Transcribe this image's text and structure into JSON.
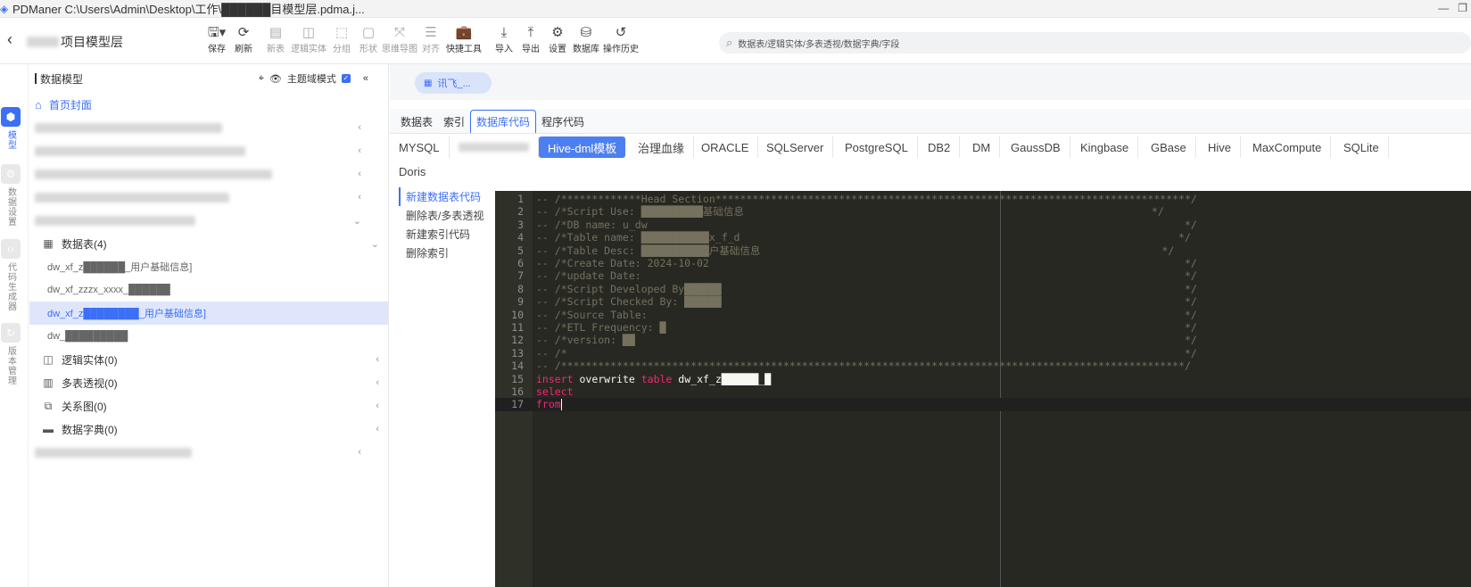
{
  "titlebar": {
    "title": "PDManer  C:\\Users\\Admin\\Desktop\\工作\\██████目模型层.pdma.j...",
    "icon": "pdmaner-logo-icon"
  },
  "toolbar": {
    "project_title": "项目模型层",
    "buttons": [
      {
        "label": "保存",
        "icon": "save-icon",
        "enabled": true
      },
      {
        "label": "刷新",
        "icon": "refresh-icon",
        "enabled": true
      },
      {
        "label": "新表",
        "icon": "new-table-icon",
        "enabled": false
      },
      {
        "label": "逻辑实体",
        "icon": "logic-entity-icon",
        "enabled": false
      },
      {
        "label": "分组",
        "icon": "group-icon",
        "enabled": false
      },
      {
        "label": "形状",
        "icon": "shape-icon",
        "enabled": false
      },
      {
        "label": "思维导图",
        "icon": "mindmap-icon",
        "enabled": false
      },
      {
        "label": "对齐",
        "icon": "align-icon",
        "enabled": false
      },
      {
        "label": "快捷工具",
        "icon": "toolbox-icon",
        "enabled": true
      },
      {
        "label": "导入",
        "icon": "import-icon",
        "enabled": true
      },
      {
        "label": "导出",
        "icon": "export-icon",
        "enabled": true
      },
      {
        "label": "设置",
        "icon": "settings-icon",
        "enabled": true
      },
      {
        "label": "数据库",
        "icon": "database-icon",
        "enabled": true
      },
      {
        "label": "操作历史",
        "icon": "history-icon",
        "enabled": true
      }
    ],
    "search_placeholder": "数据表/逻辑实体/多表透视/数据字典/字段"
  },
  "leftrail": [
    {
      "label": "模型",
      "icon": "model-cube-icon",
      "active": true
    },
    {
      "label": "数据设置",
      "icon": "data-settings-icon",
      "active": false
    },
    {
      "label": "代码生成器",
      "icon": "code-gen-icon",
      "active": false
    },
    {
      "label": "版本管理",
      "icon": "version-icon",
      "active": false
    }
  ],
  "sidebar": {
    "header": "数据模型",
    "theme_mode_label": "主题域模式",
    "home_label": "首页封面",
    "tables_group": "数据表(4)",
    "tables": [
      {
        "label": "dw_xf_z██████_用户基础信息]",
        "selected": false
      },
      {
        "label": "dw_xf_zzzx_xxxx_██████",
        "selected": false
      },
      {
        "label": "dw_xf_z████████_用户基础信息]",
        "selected": true
      },
      {
        "label": "dw_█████████",
        "selected": false
      }
    ],
    "groups": [
      {
        "label": "逻辑实体(0)",
        "icon": "logic-entity-icon"
      },
      {
        "label": "多表透视(0)",
        "icon": "pivot-icon"
      },
      {
        "label": "关系图(0)",
        "icon": "relation-icon"
      },
      {
        "label": "数据字典(0)",
        "icon": "dictionary-icon"
      }
    ]
  },
  "main": {
    "doc_tab": "讯飞_...",
    "subtabs": [
      "数据表",
      "索引",
      "数据库代码",
      "程序代码"
    ],
    "active_subtab": "数据库代码",
    "db_tabs": [
      "MYSQL",
      "██████",
      "Hive-dml模板",
      "治理血缘",
      "ORACLE",
      "SQLServer",
      "PostgreSQL",
      "DB2",
      "DM",
      "GaussDB",
      "Kingbase",
      "GBase",
      "Hive",
      "MaxCompute",
      "SQLite",
      "Doris"
    ],
    "active_db_tab": "Hive-dml模板",
    "code_nav": [
      "新建数据表代码",
      "删除表/多表透视",
      "新建索引代码",
      "删除索引"
    ],
    "active_code_nav": "新建数据表代码",
    "code_lines": [
      "-- /*************Head Section*****************************************************************************/",
      "-- /*Script Use: ██████████基础信息                                                                  */",
      "-- /*DB name: u_dw                                                                                       */",
      "-- /*Table name: ███████████x_f_d                                                                       */",
      "-- /*Table Desc: ███████████户基础信息                                                                 */",
      "-- /*Create Date: 2024-10-02                                                                             */",
      "-- /*update Date:                                                                                        */",
      "-- /*Script Developed By██████                                                                           */",
      "-- /*Script Checked By: ██████                                                                           */",
      "-- /*Source Table:                                                                                       */",
      "-- /*ETL Frequency: █                                                                                    */",
      "-- /*version: ██                                                                                         */",
      "-- /*                                                                                                    */",
      "-- /*****************************************************************************************************/",
      "insert overwrite table dw_xf_z██████_█",
      "select",
      "from"
    ]
  }
}
